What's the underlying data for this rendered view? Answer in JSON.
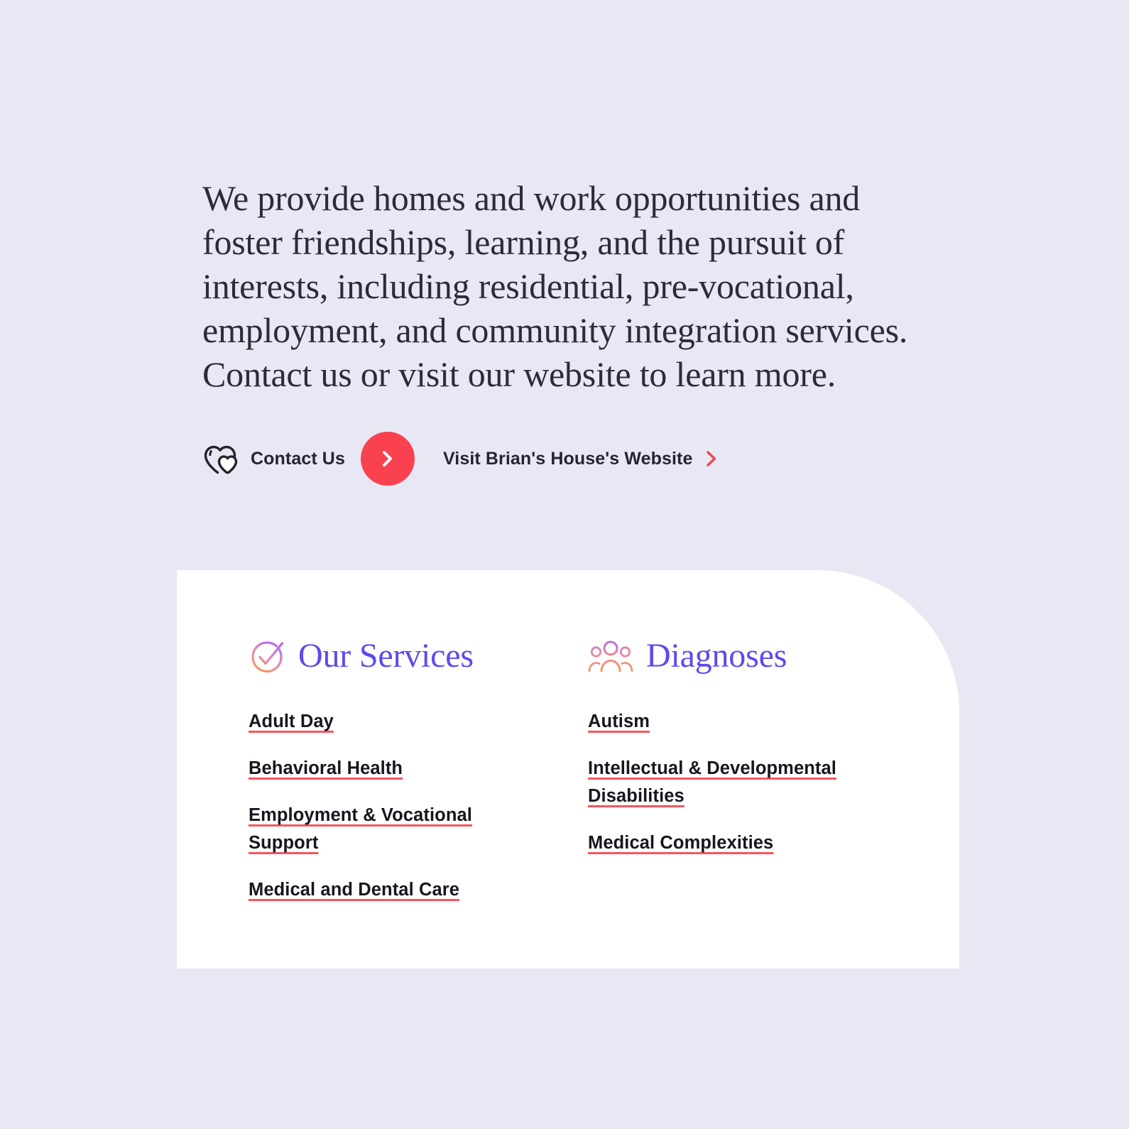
{
  "intro": {
    "paragraph": "We provide homes and work opportunities and foster friendships, learning, and the pursuit of interests, including residential, pre-vocational, employment, and community integration services. Contact us or visit our website to learn more."
  },
  "cta": {
    "contact_label": "Contact Us",
    "contact_icon": "two-hearts-icon",
    "arrow_icon": "chevron-right-icon",
    "website_label": "Visit Brian's House's Website",
    "website_icon": "chevron-right-icon"
  },
  "card": {
    "services": {
      "title": "Our Services",
      "icon": "check-circle-icon",
      "items": [
        "Adult Day",
        "Behavioral Health",
        "Employment & Vocational Support",
        "Medical and Dental Care"
      ]
    },
    "diagnoses": {
      "title": "Diagnoses",
      "icon": "people-group-icon",
      "items": [
        "Autism",
        "Intellectual & Developmental Disabilities",
        "Medical Complexities"
      ]
    }
  },
  "colors": {
    "background": "#e8e8f4",
    "card_background": "#ffffff",
    "accent_red": "#f9414f",
    "underline_red": "#f9555f",
    "title_purple": "#5b4bf0",
    "body_text": "#2b2b3a",
    "icon_gradient_start": "#b06ce8",
    "icon_gradient_end": "#f79a5c"
  }
}
